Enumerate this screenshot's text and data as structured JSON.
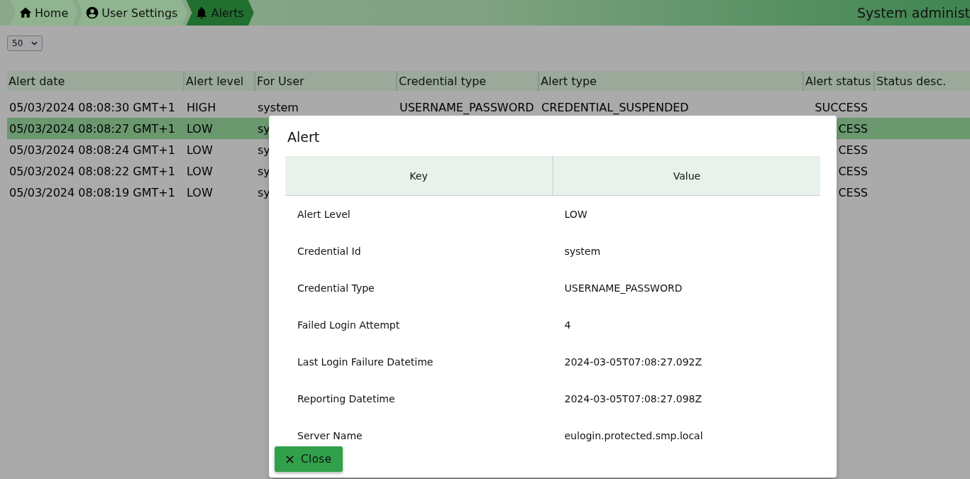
{
  "breadcrumbs": [
    {
      "label": "Home",
      "selected": false
    },
    {
      "label": "User Settings",
      "selected": false
    },
    {
      "label": "Alerts",
      "selected": true
    }
  ],
  "header_title": "System administ",
  "page_size": {
    "value": "50"
  },
  "table": {
    "columns": [
      "Alert date",
      "Alert level",
      "For User",
      "Credential type",
      "Alert type",
      "Alert status",
      "Status desc."
    ],
    "rows": [
      {
        "selected": false,
        "cells": [
          "05/03/2024 08:08:30 GMT+1",
          "HIGH",
          "system",
          "USERNAME_PASSWORD",
          "CREDENTIAL_SUSPENDED",
          "SUCCESS",
          null
        ]
      },
      {
        "selected": true,
        "cells": [
          "05/03/2024 08:08:27 GMT+1",
          "LOW",
          "sy",
          null,
          null,
          "CESS",
          null
        ]
      },
      {
        "selected": false,
        "cells": [
          "05/03/2024 08:08:24 GMT+1",
          "LOW",
          "sy",
          null,
          null,
          "CESS",
          null
        ]
      },
      {
        "selected": false,
        "cells": [
          "05/03/2024 08:08:22 GMT+1",
          "LOW",
          "sy",
          null,
          null,
          "CESS",
          null
        ]
      },
      {
        "selected": false,
        "cells": [
          "05/03/2024 08:08:19 GMT+1",
          "LOW",
          "sy",
          null,
          null,
          "CESS",
          null
        ]
      }
    ]
  },
  "dialog": {
    "title": "Alert",
    "columns": [
      "Key",
      "Value"
    ],
    "rows": [
      [
        "Alert Level",
        "LOW"
      ],
      [
        "Credential Id",
        "system"
      ],
      [
        "Credential Type",
        "USERNAME_PASSWORD"
      ],
      [
        "Failed Login Attempt",
        "4"
      ],
      [
        "Last Login Failure Datetime",
        "2024-03-05T07:08:27.092Z"
      ],
      [
        "Reporting Datetime",
        "2024-03-05T07:08:27.098Z"
      ],
      [
        "Server Name",
        "eulogin.protected.smp.local"
      ]
    ],
    "close_button": "Close"
  }
}
